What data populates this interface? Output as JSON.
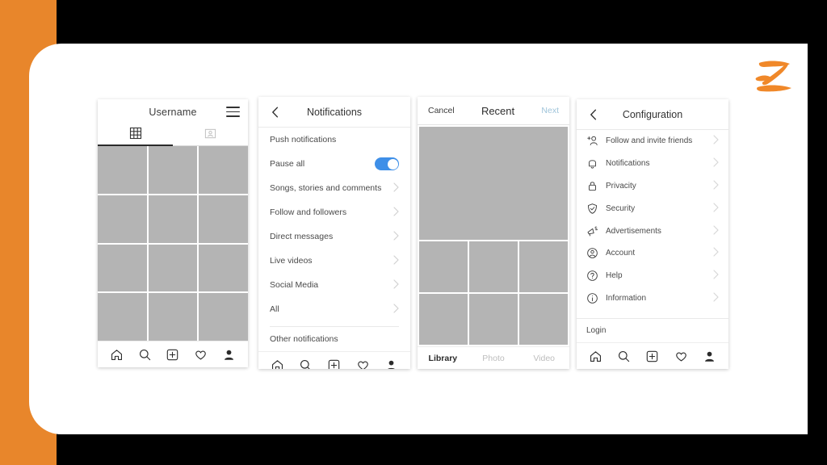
{
  "theme": {
    "accent_orange": "#E8862B",
    "toggle_blue": "#3E8FE8",
    "next_link_blue": "#9FC4DA",
    "placeholder_gray": "#B4B4B4",
    "letterbox_black": "#000000",
    "card_white": "#FFFFFF"
  },
  "logo": {
    "name": "brand-logo-z",
    "letter": "Z",
    "color": "#F08829"
  },
  "profile_screen": {
    "title": "Username",
    "menu_icon": "hamburger-icon",
    "tabs": [
      {
        "icon": "grid-icon",
        "active": true
      },
      {
        "icon": "tagged-photo-icon",
        "active": false
      }
    ],
    "grid_rows": 4,
    "grid_cols": 3,
    "nav": [
      {
        "icon": "home-icon",
        "label": "Home"
      },
      {
        "icon": "search-icon",
        "label": "Search"
      },
      {
        "icon": "add-post-icon",
        "label": "Add"
      },
      {
        "icon": "heart-icon",
        "label": "Activity"
      },
      {
        "icon": "profile-icon",
        "label": "Profile"
      }
    ]
  },
  "notifications_screen": {
    "back_icon": "chevron-left-icon",
    "title": "Notifications",
    "section_label": "Push notifications",
    "toggle_row": {
      "label": "Pause all",
      "state": "on"
    },
    "items": [
      {
        "label": "Songs, stories and comments",
        "chevron": true
      },
      {
        "label": "Follow and followers",
        "chevron": true
      },
      {
        "label": "Direct messages",
        "chevron": true
      },
      {
        "label": "Live videos",
        "chevron": true
      },
      {
        "label": "Social Media",
        "chevron": true
      },
      {
        "label": "All",
        "chevron": true
      }
    ],
    "footer_label": "Other notifications",
    "nav": [
      {
        "icon": "home-icon",
        "label": "Home"
      },
      {
        "icon": "search-icon",
        "label": "Search"
      },
      {
        "icon": "add-post-icon",
        "label": "Add"
      },
      {
        "icon": "heart-icon",
        "label": "Activity"
      },
      {
        "icon": "profile-icon",
        "label": "Profile"
      }
    ]
  },
  "picker_screen": {
    "cancel_label": "Cancel",
    "title": "Recent",
    "next_label": "Next",
    "preview": "selected-photo-placeholder",
    "thumb_rows": 2,
    "thumb_cols": 3,
    "tabs": [
      {
        "label": "Library",
        "active": true
      },
      {
        "label": "Photo",
        "active": false
      },
      {
        "label": "Video",
        "active": false
      }
    ]
  },
  "configuration_screen": {
    "back_icon": "chevron-left-icon",
    "title": "Configuration",
    "items": [
      {
        "label": "Follow and invite friends",
        "icon": "add-person-icon"
      },
      {
        "label": "Notifications",
        "icon": "bell-icon"
      },
      {
        "label": "Privacity",
        "icon": "lock-icon"
      },
      {
        "label": "Security",
        "icon": "shield-check-icon"
      },
      {
        "label": "Advertisements",
        "icon": "megaphone-icon"
      },
      {
        "label": "Account",
        "icon": "account-circle-icon"
      },
      {
        "label": "Help",
        "icon": "question-circle-icon"
      },
      {
        "label": "Information",
        "icon": "info-circle-icon"
      }
    ],
    "footer_label": "Login",
    "nav": [
      {
        "icon": "home-icon",
        "label": "Home"
      },
      {
        "icon": "search-icon",
        "label": "Search"
      },
      {
        "icon": "add-post-icon",
        "label": "Add"
      },
      {
        "icon": "heart-icon",
        "label": "Activity"
      },
      {
        "icon": "profile-icon",
        "label": "Profile"
      }
    ]
  }
}
